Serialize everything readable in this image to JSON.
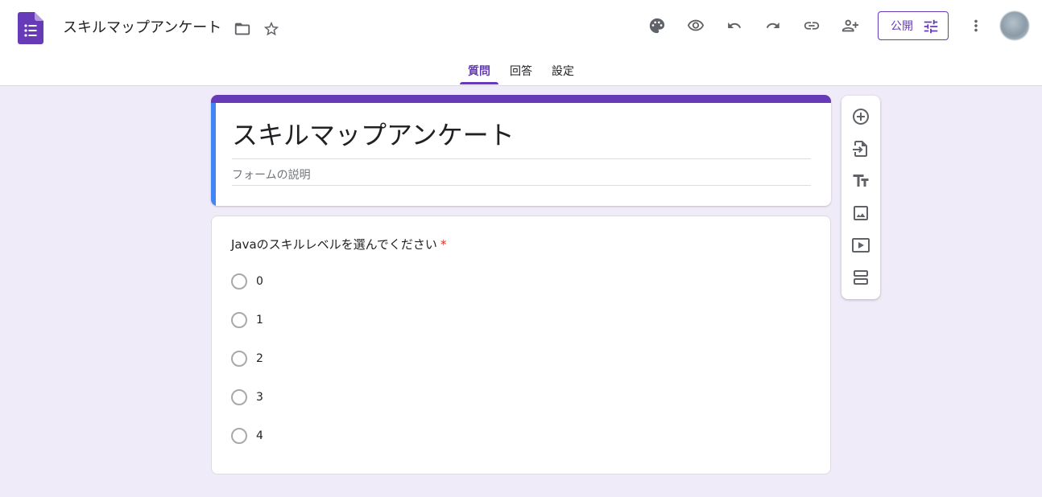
{
  "header": {
    "app_icon": "google-forms-icon",
    "title": "スキルマップアンケート",
    "folder_icon": "folder-icon",
    "star_icon": "star-icon",
    "actions": [
      "palette-icon",
      "preview-eye-icon",
      "undo-icon",
      "redo-icon",
      "link-icon",
      "add-collaborator-icon"
    ],
    "publish_label": "公開",
    "more_icon": "more-vert-icon",
    "avatar": "user-avatar"
  },
  "tabs": [
    {
      "label": "質問",
      "active": true
    },
    {
      "label": "回答",
      "active": false
    },
    {
      "label": "設定",
      "active": false
    }
  ],
  "form": {
    "title": "スキルマップアンケート",
    "description_placeholder": "フォームの説明",
    "theme_color": "#673ab7",
    "accent_color": "#4285f4",
    "background_color": "#f0ebf8"
  },
  "question": {
    "text": "Javaのスキルレベルを選んでください",
    "required_mark": "*",
    "options": [
      "0",
      "1",
      "2",
      "3",
      "4"
    ]
  },
  "side_toolbar": [
    "add-question-icon",
    "import-questions-icon",
    "add-title-icon",
    "add-image-icon",
    "add-video-icon",
    "add-section-icon"
  ]
}
